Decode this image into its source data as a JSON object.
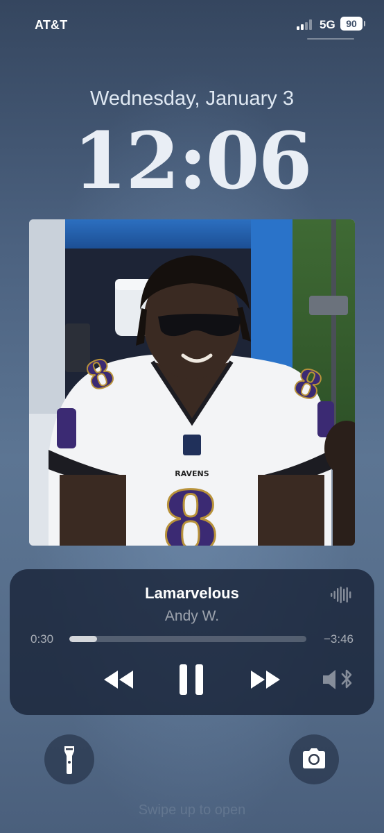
{
  "status_bar": {
    "carrier": "AT&T",
    "network": "5G",
    "battery_percent": "90"
  },
  "lock_screen": {
    "date": "Wednesday, January 3",
    "time": "12:06"
  },
  "album_art": {
    "jersey_brand": "RAVENS",
    "jersey_number": "8"
  },
  "now_playing": {
    "title": "Lamarvelous",
    "artist": "Andy W.",
    "elapsed": "0:30",
    "remaining": "−3:46",
    "progress_fraction": 0.117
  },
  "icons": {
    "waveform": "waveform-icon",
    "rewind": "rewind-icon",
    "pause": "pause-icon",
    "fast_forward": "fast-forward-icon",
    "audio_output": "speaker-bluetooth-icon",
    "flashlight": "flashlight-icon",
    "camera": "camera-icon"
  },
  "footer": {
    "swipe_hint": "Swipe up to open"
  },
  "colors": {
    "jersey_purple": "#3b2a73",
    "jersey_gold": "#b8923a",
    "widget_bg": "#16203a"
  }
}
